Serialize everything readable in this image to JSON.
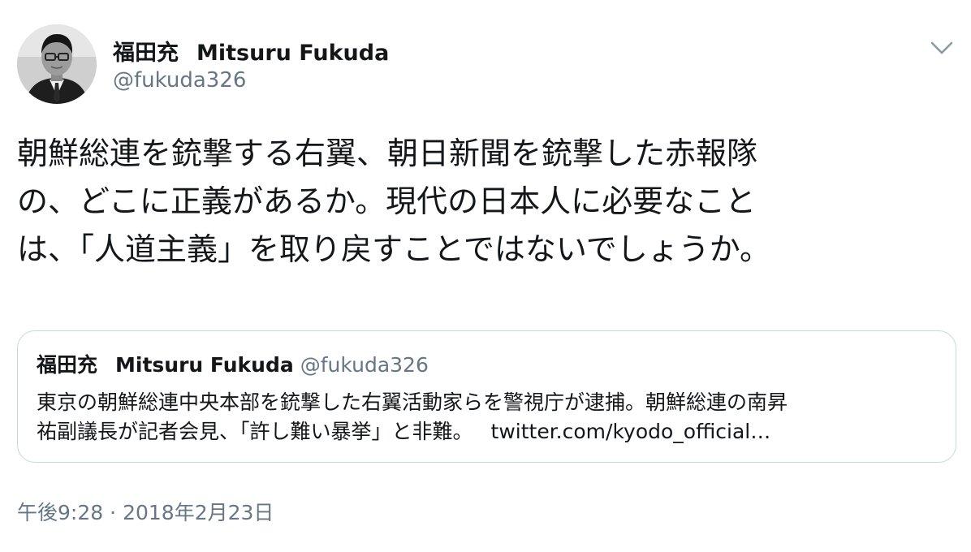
{
  "author": {
    "name_jp": "福田充",
    "name_en": "Mitsuru Fukuda",
    "handle": "@fukuda326"
  },
  "menu": {
    "icon": "chevron-down-icon"
  },
  "tweet": {
    "lines": [
      "朝鮮総連を銃撃する右翼、朝日新聞を銃撃した赤報隊",
      "の、どこに正義があるか。現代の日本人に必要なこと",
      "は、「人道主義」を取り戻すことではないでしょうか。"
    ]
  },
  "quote": {
    "name_jp": "福田充",
    "name_en": "Mitsuru Fukuda",
    "handle": "@fukuda326",
    "lines": [
      "東京の朝鮮総連中央本部を銃撃した右翼活動家らを警視庁が逮捕。朝鮮総連の南昇",
      "祐副議長が記者会見、「許し難い暴挙」と非難。"
    ],
    "link": "twitter.com/kyodo_official…"
  },
  "timestamp": {
    "time": "午後9:28",
    "separator": "·",
    "date": "2018年2月23日"
  },
  "colors": {
    "text": "#14171a",
    "secondary": "#657786",
    "border": "#ccd6dd"
  }
}
